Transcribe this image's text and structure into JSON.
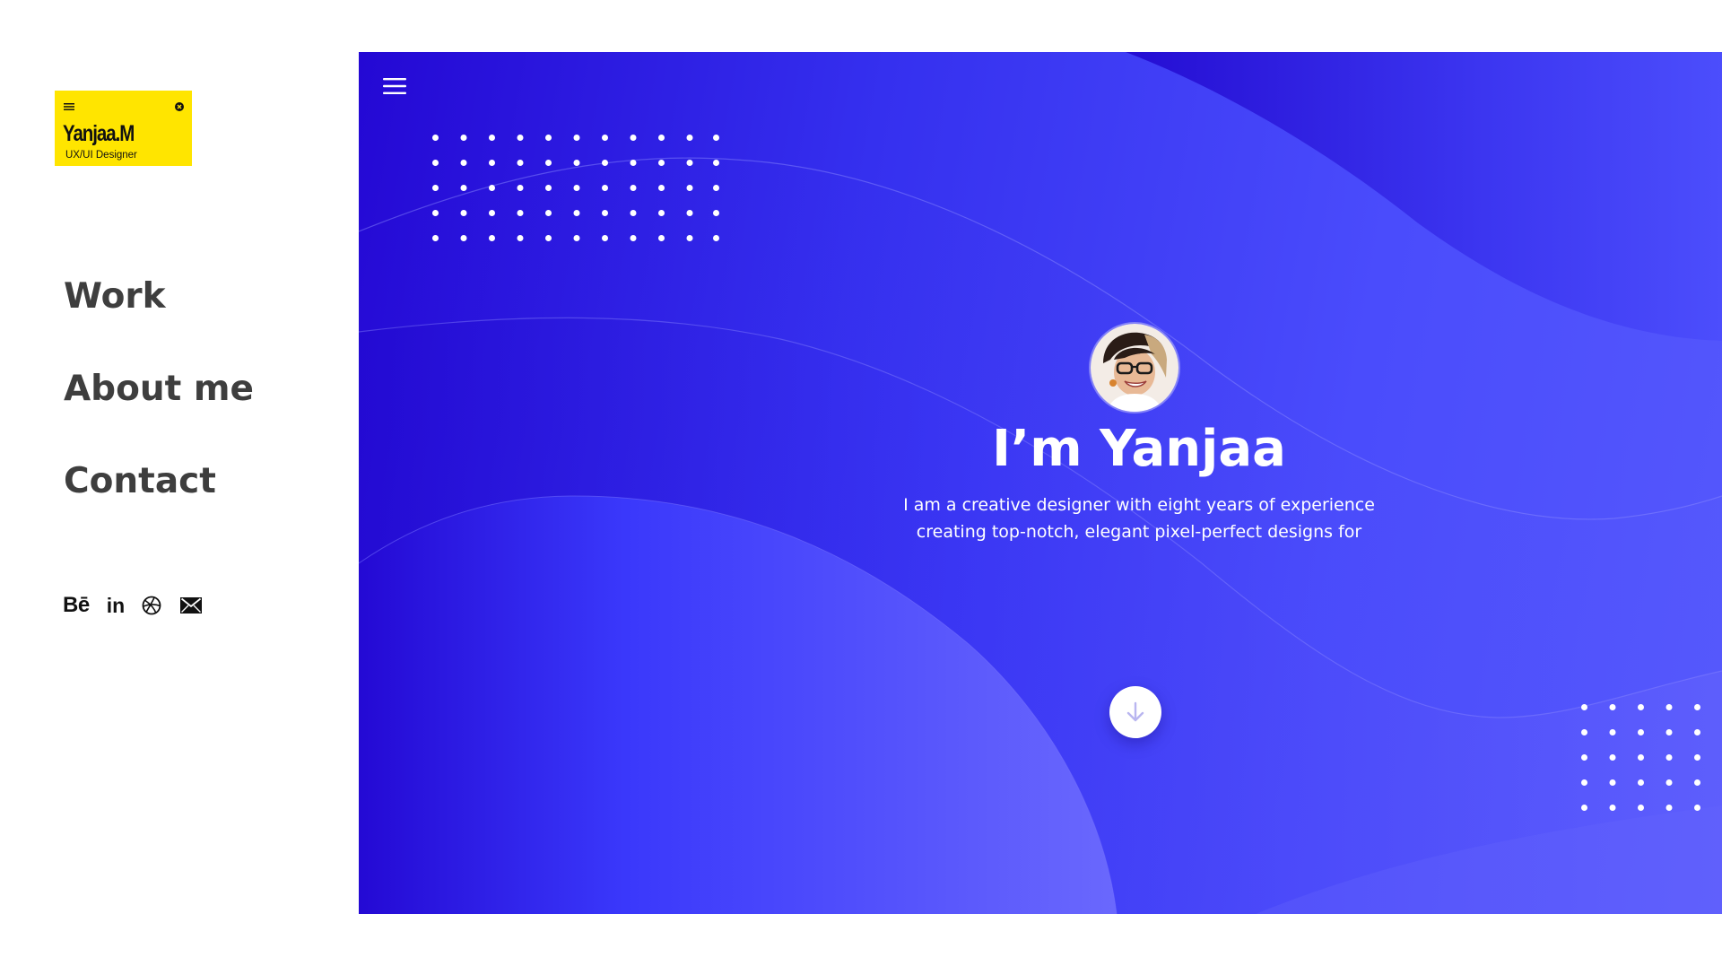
{
  "brand": {
    "name": "Yanjaa.M",
    "role": "UX/UI Designer",
    "card_color": "#ffe500"
  },
  "nav": {
    "items": [
      {
        "label": "Work"
      },
      {
        "label": "About me"
      },
      {
        "label": "Contact"
      }
    ]
  },
  "social": {
    "behance_label": "Bē",
    "linkedin_label": "in",
    "icons": [
      "behance-icon",
      "linkedin-icon",
      "dribbble-icon",
      "mail-icon"
    ]
  },
  "hero": {
    "title": "I’m Yanjaa",
    "description_line1": "I am a creative designer with eight years of experience",
    "description_line2": "creating top-notch, elegant pixel-perfect designs for",
    "gradient_start": "#2408d4",
    "gradient_end": "#5558fc",
    "menu_icon": "hamburger-icon",
    "avatar_icon": "profile-photo",
    "scroll_icon": "arrow-down-icon"
  }
}
